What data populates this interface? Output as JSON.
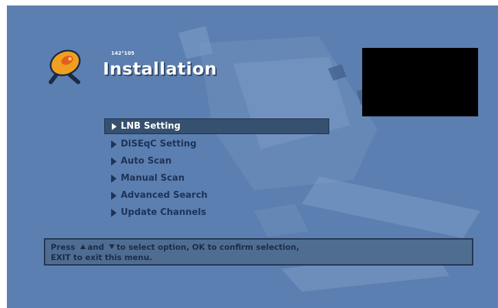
{
  "header": {
    "subtitle": "142°105",
    "title": "Installation"
  },
  "menu": {
    "items": [
      {
        "label": "LNB Setting",
        "selected": true
      },
      {
        "label": "DiSEqC Setting",
        "selected": false
      },
      {
        "label": "Auto Scan",
        "selected": false
      },
      {
        "label": "Manual Scan",
        "selected": false
      },
      {
        "label": "Advanced Search",
        "selected": false
      },
      {
        "label": "Update Channels",
        "selected": false
      }
    ]
  },
  "help": {
    "press": "Press",
    "and": "and",
    "rest_line1": "to select option, OK to confirm selection,",
    "line2": "EXIT to exit this menu."
  },
  "colors": {
    "background": "#5b7fb0",
    "selected_bg": "#36506f",
    "text_dark": "#1e3358",
    "preview": "#000000"
  },
  "icons": {
    "logo": "satellite-dish-icon",
    "menu_bullet": "triangle-right-icon",
    "up": "triangle-up-icon",
    "down": "triangle-down-icon"
  }
}
